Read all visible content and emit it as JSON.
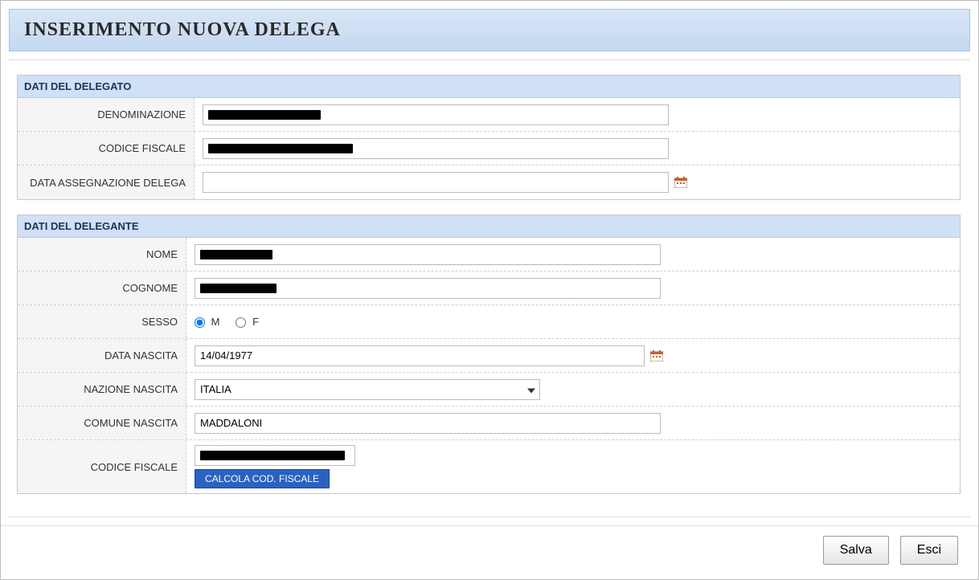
{
  "dialog": {
    "title": "INSERIMENTO NUOVA DELEGA"
  },
  "delegato": {
    "section_title": "DATI DEL DELEGATO",
    "labels": {
      "denominazione": "DENOMINAZIONE",
      "codice_fiscale": "CODICE FISCALE",
      "data_assegnazione": "DATA ASSEGNAZIONE DELEGA"
    },
    "values": {
      "denominazione": "████████████",
      "codice_fiscale": "█████████████████",
      "data_assegnazione": ""
    }
  },
  "delegante": {
    "section_title": "DATI DEL DELEGANTE",
    "labels": {
      "nome": "NOME",
      "cognome": "COGNOME",
      "sesso": "SESSO",
      "data_nascita": "DATA NASCITA",
      "nazione_nascita": "NAZIONE NASCITA",
      "comune_nascita": "COMUNE NASCITA",
      "codice_fiscale": "CODICE FISCALE"
    },
    "values": {
      "nome": "█████████",
      "cognome": "█████████",
      "sesso": "M",
      "sesso_m_label": "M",
      "sesso_f_label": "F",
      "data_nascita": "14/04/1977",
      "nazione_nascita": "ITALIA",
      "comune_nascita": "MADDALONI",
      "codice_fiscale": "████████████████",
      "calcola_btn": "CALCOLA COD. FISCALE"
    }
  },
  "footer": {
    "save": "Salva",
    "exit": "Esci"
  }
}
